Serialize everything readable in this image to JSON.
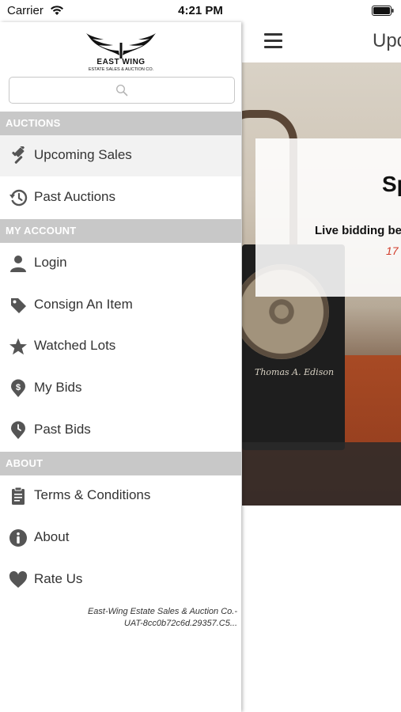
{
  "status_bar": {
    "carrier": "Carrier",
    "time": "4:21 PM"
  },
  "logo": {
    "title": "EAST WING",
    "subtitle": "ESTATE SALES & AUCTION CO."
  },
  "search": {
    "placeholder": ""
  },
  "sections": {
    "auctions": "AUCTIONS",
    "my_account": "MY ACCOUNT",
    "about": "ABOUT"
  },
  "menu": {
    "upcoming_sales": {
      "label": "Upcoming Sales",
      "icon": "gavel-icon"
    },
    "past_auctions": {
      "label": "Past Auctions",
      "icon": "history-icon"
    },
    "login": {
      "label": "Login",
      "icon": "user-icon"
    },
    "consign": {
      "label": "Consign An Item",
      "icon": "tag-icon"
    },
    "watched": {
      "label": "Watched Lots",
      "icon": "star-icon"
    },
    "my_bids": {
      "label": "My Bids",
      "icon": "dollar-pin-icon"
    },
    "past_bids": {
      "label": "Past Bids",
      "icon": "clock-pin-icon"
    },
    "terms": {
      "label": "Terms & Conditions",
      "icon": "clipboard-icon"
    },
    "about": {
      "label": "About",
      "icon": "info-icon"
    },
    "rate": {
      "label": "Rate Us",
      "icon": "heart-icon"
    }
  },
  "footer": {
    "line1": "East-Wing Estate Sales & Auction Co.-",
    "line2": "UAT-8cc0b72c6d.29357.C5..."
  },
  "main": {
    "nav_title": "Upc",
    "card_heading": "Sp",
    "card_sub": "Live bidding be",
    "card_date": "17",
    "hero_brand": "Thomas A. Edison"
  },
  "colors": {
    "section_header": "#c8c8c8",
    "active_item": "#f2f2f2",
    "icon": "#555555",
    "date_red": "#d23b2a"
  }
}
